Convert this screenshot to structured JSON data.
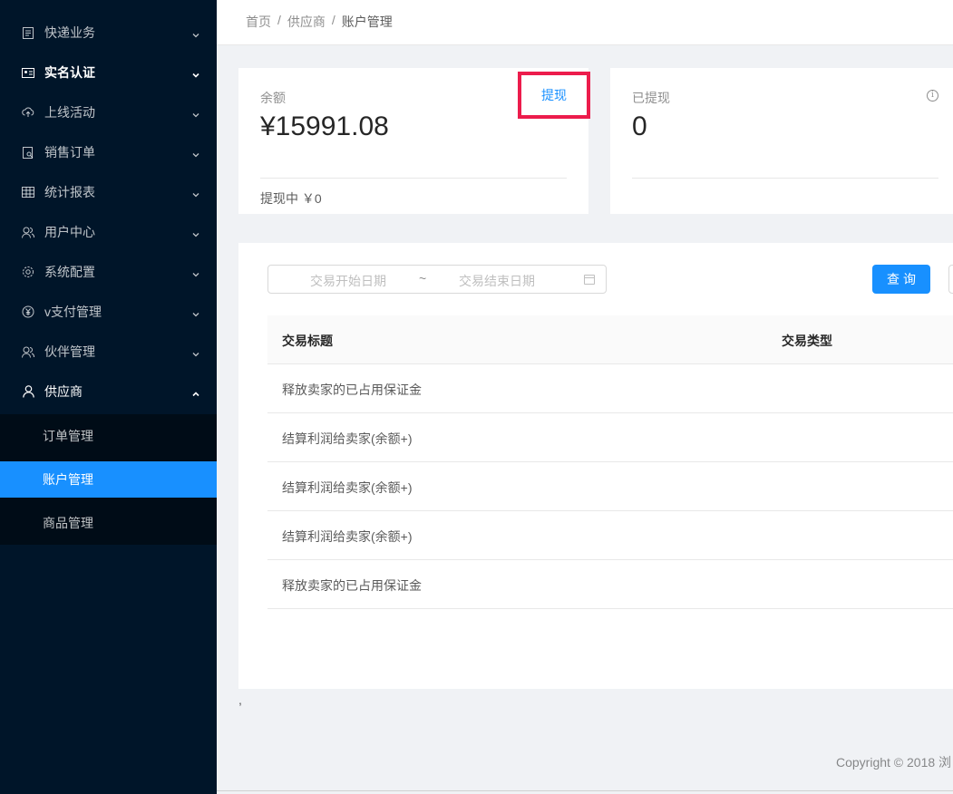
{
  "sidebar": {
    "items": [
      {
        "label": "快递业务",
        "icon": "file-text-icon"
      },
      {
        "label": "实名认证",
        "icon": "idcard-icon"
      },
      {
        "label": "上线活动",
        "icon": "cloud-upload-icon"
      },
      {
        "label": "销售订单",
        "icon": "file-search-icon"
      },
      {
        "label": "统计报表",
        "icon": "table-icon"
      },
      {
        "label": "用户中心",
        "icon": "team-icon"
      },
      {
        "label": "系统配置",
        "icon": "setting-icon"
      },
      {
        "label": "v支付管理",
        "icon": "pay-circle-icon"
      },
      {
        "label": "伙伴管理",
        "icon": "team-icon"
      },
      {
        "label": "供应商",
        "icon": "user-icon"
      }
    ],
    "submenu": [
      {
        "label": "订单管理"
      },
      {
        "label": "账户管理"
      },
      {
        "label": "商品管理"
      }
    ]
  },
  "breadcrumb": [
    "首页",
    "供应商",
    "账户管理"
  ],
  "balance_card": {
    "label": "余额",
    "value": "¥15991.08",
    "withdraw_label": "提现",
    "footer": "提现中 ￥0"
  },
  "withdrawn_card": {
    "label": "已提现",
    "value": "0",
    "info_icon": "i"
  },
  "filter": {
    "start_placeholder": "交易开始日期",
    "separator": "~",
    "end_placeholder": "交易结束日期",
    "query_label": "查询"
  },
  "table": {
    "columns": [
      "交易标题",
      "交易类型"
    ],
    "rows": [
      {
        "title": "释放卖家的已占用保证金"
      },
      {
        "title": "结算利润给卖家(余额+)"
      },
      {
        "title": "结算利润给卖家(余额+)"
      },
      {
        "title": "结算利润给卖家(余额+)"
      },
      {
        "title": "释放卖家的已占用保证金"
      }
    ]
  },
  "stray_text": ",",
  "footer": "Copyright © 2018 浏"
}
